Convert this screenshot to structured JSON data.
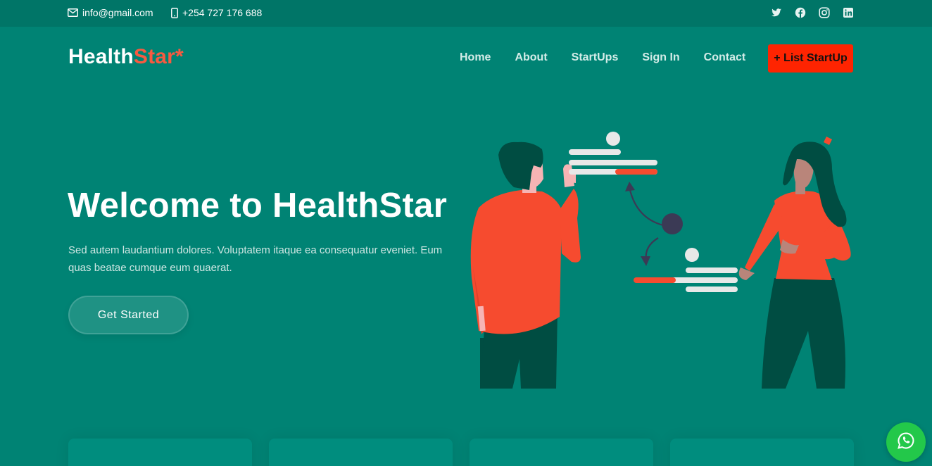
{
  "topbar": {
    "email": "info@gmail.com",
    "phone": "+254 727 176 688",
    "social_icons": [
      "twitter-icon",
      "facebook-icon",
      "instagram-icon",
      "linkedin-icon"
    ]
  },
  "header": {
    "logo_main": "Health",
    "logo_accent": "Star*",
    "nav": [
      "Home",
      "About",
      "StartUps",
      "Sign In",
      "Contact"
    ],
    "cta": "+ List StartUp"
  },
  "hero": {
    "title": "Welcome to HealthStar",
    "text": "Sed autem laudantium dolores. Voluptatem itaque ea consequatur eveniet. Eum quas beatae cumque eum quaerat.",
    "button": "Get Started"
  },
  "colors": {
    "background": "#008374",
    "topbar": "#007567",
    "accent": "#f85a40",
    "cta": "#fe2401",
    "whatsapp": "#23c84a"
  }
}
